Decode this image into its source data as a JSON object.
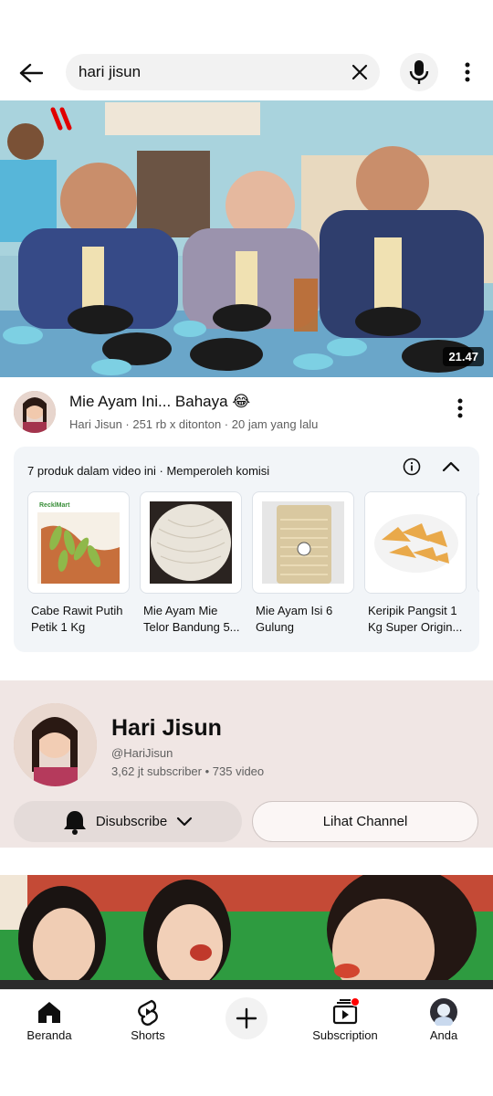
{
  "search": {
    "query": "hari jisun"
  },
  "video": {
    "duration": "21.47",
    "title": "Mie Ayam Ini... Bahaya 😂",
    "meta": "Hari Jisun · 251 rb x ditonton · 20 jam yang lalu"
  },
  "products": {
    "header": "7 produk dalam video ini  · Memperoleh komisi",
    "items": [
      {
        "name": "Cabe Rawit Putih Petik 1 Kg",
        "badge": "RecklMart"
      },
      {
        "name": "Mie Ayam Mie Telor Bandung 5..."
      },
      {
        "name": "Mie Ayam Isi 6 Gulung"
      },
      {
        "name": "Keripik Pangsit 1 Kg Super Origin..."
      }
    ]
  },
  "channel": {
    "name": "Hari Jisun",
    "handle": "@HariJisun",
    "stats": "3,62 jt subscriber • 735 video",
    "subscribe_label": "Disubscribe",
    "view_label": "Lihat Channel"
  },
  "nav": {
    "home": "Beranda",
    "shorts": "Shorts",
    "subscriptions": "Subscription",
    "you": "Anda"
  },
  "colors": {
    "notification_dot": "#ff0000",
    "channel_bg": "#f0e6e4",
    "products_bg": "#f2f5f8"
  }
}
